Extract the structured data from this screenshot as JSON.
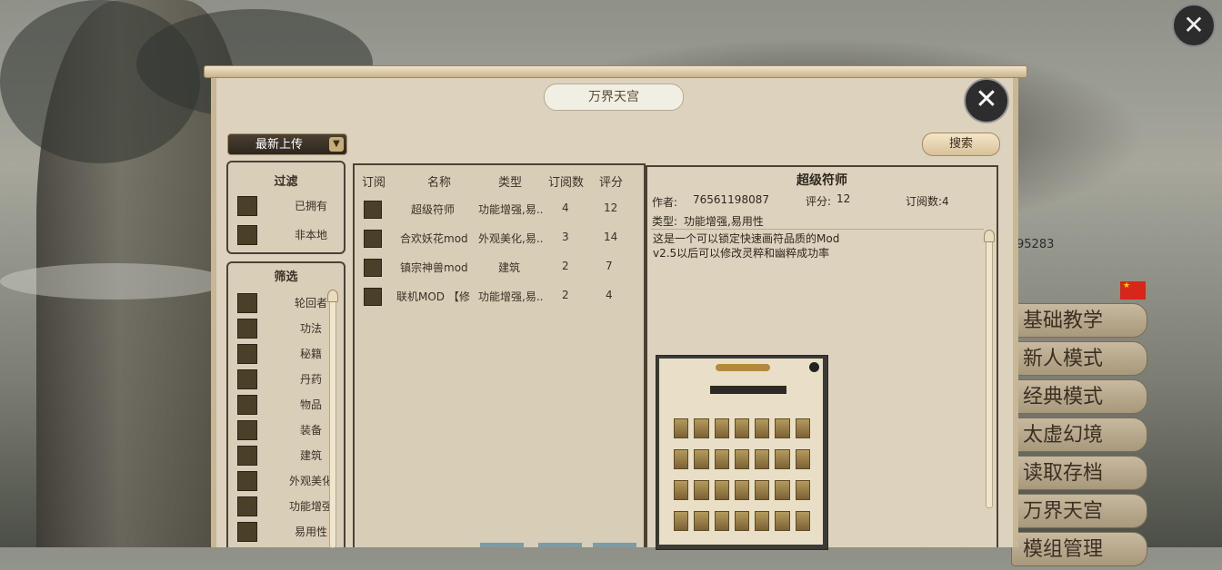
{
  "background": {
    "version_text": "95283",
    "close_glyph": "✕"
  },
  "main_menu": {
    "items": [
      "基础教学",
      "新人模式",
      "经典模式",
      "太虚幻境",
      "读取存档",
      "万界天宫",
      "模组管理"
    ]
  },
  "dialog": {
    "title": "万界天宫",
    "close_glyph": "✕",
    "sort_dropdown": {
      "selected": "最新上传",
      "arrow": "▼"
    },
    "search_label": "搜索"
  },
  "filter_panel": {
    "title": "过滤",
    "options": [
      "已拥有",
      "非本地"
    ]
  },
  "screen_panel": {
    "title": "筛选",
    "options": [
      "轮回者",
      "功法",
      "秘籍",
      "丹药",
      "物品",
      "装备",
      "建筑",
      "外观美化",
      "功能增强",
      "易用性"
    ]
  },
  "mod_list": {
    "headers": [
      "订阅",
      "名称",
      "类型",
      "订阅数",
      "评分"
    ],
    "rows": [
      {
        "name": "超级符师",
        "type": "功能增强,易..",
        "subs": "4",
        "score": "12"
      },
      {
        "name": "合欢妖花mod",
        "type": "外观美化,易..",
        "subs": "3",
        "score": "14"
      },
      {
        "name": "镇宗神兽mod",
        "type": "建筑",
        "subs": "2",
        "score": "7"
      },
      {
        "name": "联机MOD 【修",
        "type": "功能增强,易..",
        "subs": "2",
        "score": "4"
      }
    ]
  },
  "detail": {
    "title": "超级符师",
    "author_label": "作者:",
    "author_id": "76561198087",
    "score_label": "评分:",
    "score": "12",
    "subs_text": "订阅数:4",
    "type_label": "类型:",
    "type_value": "功能增强,易用性",
    "description": [
      "这是一个可以锁定快速画符品质的Mod",
      "v2.5以后可以修改灵粹和幽粹成功率"
    ]
  },
  "colors": {
    "parchment": "#ddd2bd",
    "panel_border": "#4b4235",
    "checkbox": "#4a4028",
    "flag_red": "#d8261b"
  }
}
